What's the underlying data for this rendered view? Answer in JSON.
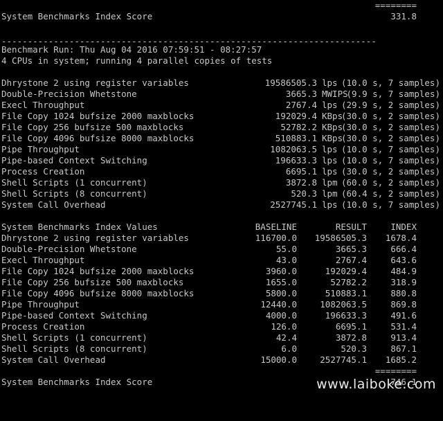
{
  "score_top": {
    "underline": "========",
    "label": "System Benchmarks Index Score",
    "value": "331.8"
  },
  "separator": "------------------------------------------------------------------------",
  "run": {
    "line": "Benchmark Run: Thu Aug 04 2016 07:59:51 - 08:27:57",
    "cpus": "4 CPUs in system; running 4 parallel copies of tests"
  },
  "results": [
    {
      "name": "Dhrystone 2 using register variables",
      "value": "19586505.3",
      "unit": "lps",
      "detail": "(10.0 s, 7 samples)"
    },
    {
      "name": "Double-Precision Whetstone",
      "value": "3665.3",
      "unit": "MWIPS",
      "detail": "(9.9 s, 7 samples)"
    },
    {
      "name": "Execl Throughput",
      "value": "2767.4",
      "unit": "lps",
      "detail": "(29.9 s, 2 samples)"
    },
    {
      "name": "File Copy 1024 bufsize 2000 maxblocks",
      "value": "192029.4",
      "unit": "KBps",
      "detail": "(30.0 s, 2 samples)"
    },
    {
      "name": "File Copy 256 bufsize 500 maxblocks",
      "value": "52782.2",
      "unit": "KBps",
      "detail": "(30.0 s, 2 samples)"
    },
    {
      "name": "File Copy 4096 bufsize 8000 maxblocks",
      "value": "510883.1",
      "unit": "KBps",
      "detail": "(30.0 s, 2 samples)"
    },
    {
      "name": "Pipe Throughput",
      "value": "1082063.5",
      "unit": "lps",
      "detail": "(10.0 s, 7 samples)"
    },
    {
      "name": "Pipe-based Context Switching",
      "value": "196633.3",
      "unit": "lps",
      "detail": "(10.0 s, 7 samples)"
    },
    {
      "name": "Process Creation",
      "value": "6695.1",
      "unit": "lps",
      "detail": "(30.0 s, 2 samples)"
    },
    {
      "name": "Shell Scripts (1 concurrent)",
      "value": "3872.8",
      "unit": "lpm",
      "detail": "(60.0 s, 2 samples)"
    },
    {
      "name": "Shell Scripts (8 concurrent)",
      "value": "520.3",
      "unit": "lpm",
      "detail": "(60.4 s, 2 samples)"
    },
    {
      "name": "System Call Overhead",
      "value": "2527745.1",
      "unit": "lps",
      "detail": "(10.0 s, 7 samples)"
    }
  ],
  "index": {
    "headers": {
      "label": "System Benchmarks Index Values",
      "baseline": "BASELINE",
      "result": "RESULT",
      "index": "INDEX"
    },
    "rows": [
      {
        "name": "Dhrystone 2 using register variables",
        "baseline": "116700.0",
        "result": "19586505.3",
        "index": "1678.4"
      },
      {
        "name": "Double-Precision Whetstone",
        "baseline": "55.0",
        "result": "3665.3",
        "index": "666.4"
      },
      {
        "name": "Execl Throughput",
        "baseline": "43.0",
        "result": "2767.4",
        "index": "643.6"
      },
      {
        "name": "File Copy 1024 bufsize 2000 maxblocks",
        "baseline": "3960.0",
        "result": "192029.4",
        "index": "484.9"
      },
      {
        "name": "File Copy 256 bufsize 500 maxblocks",
        "baseline": "1655.0",
        "result": "52782.2",
        "index": "318.9"
      },
      {
        "name": "File Copy 4096 bufsize 8000 maxblocks",
        "baseline": "5800.0",
        "result": "510883.1",
        "index": "880.8"
      },
      {
        "name": "Pipe Throughput",
        "baseline": "12440.0",
        "result": "1082063.5",
        "index": "869.8"
      },
      {
        "name": "Pipe-based Context Switching",
        "baseline": "4000.0",
        "result": "196633.3",
        "index": "491.6"
      },
      {
        "name": "Process Creation",
        "baseline": "126.0",
        "result": "6695.1",
        "index": "531.4"
      },
      {
        "name": "Shell Scripts (1 concurrent)",
        "baseline": "42.4",
        "result": "3872.8",
        "index": "913.4"
      },
      {
        "name": "Shell Scripts (8 concurrent)",
        "baseline": "6.0",
        "result": "520.3",
        "index": "867.1"
      },
      {
        "name": "System Call Overhead",
        "baseline": "15000.0",
        "result": "2527745.1",
        "index": "1685.2"
      }
    ],
    "underline": "========"
  },
  "score_bottom": {
    "label": "System Benchmarks Index Score",
    "value": "746.1"
  },
  "watermark": "www.laiboke.com"
}
